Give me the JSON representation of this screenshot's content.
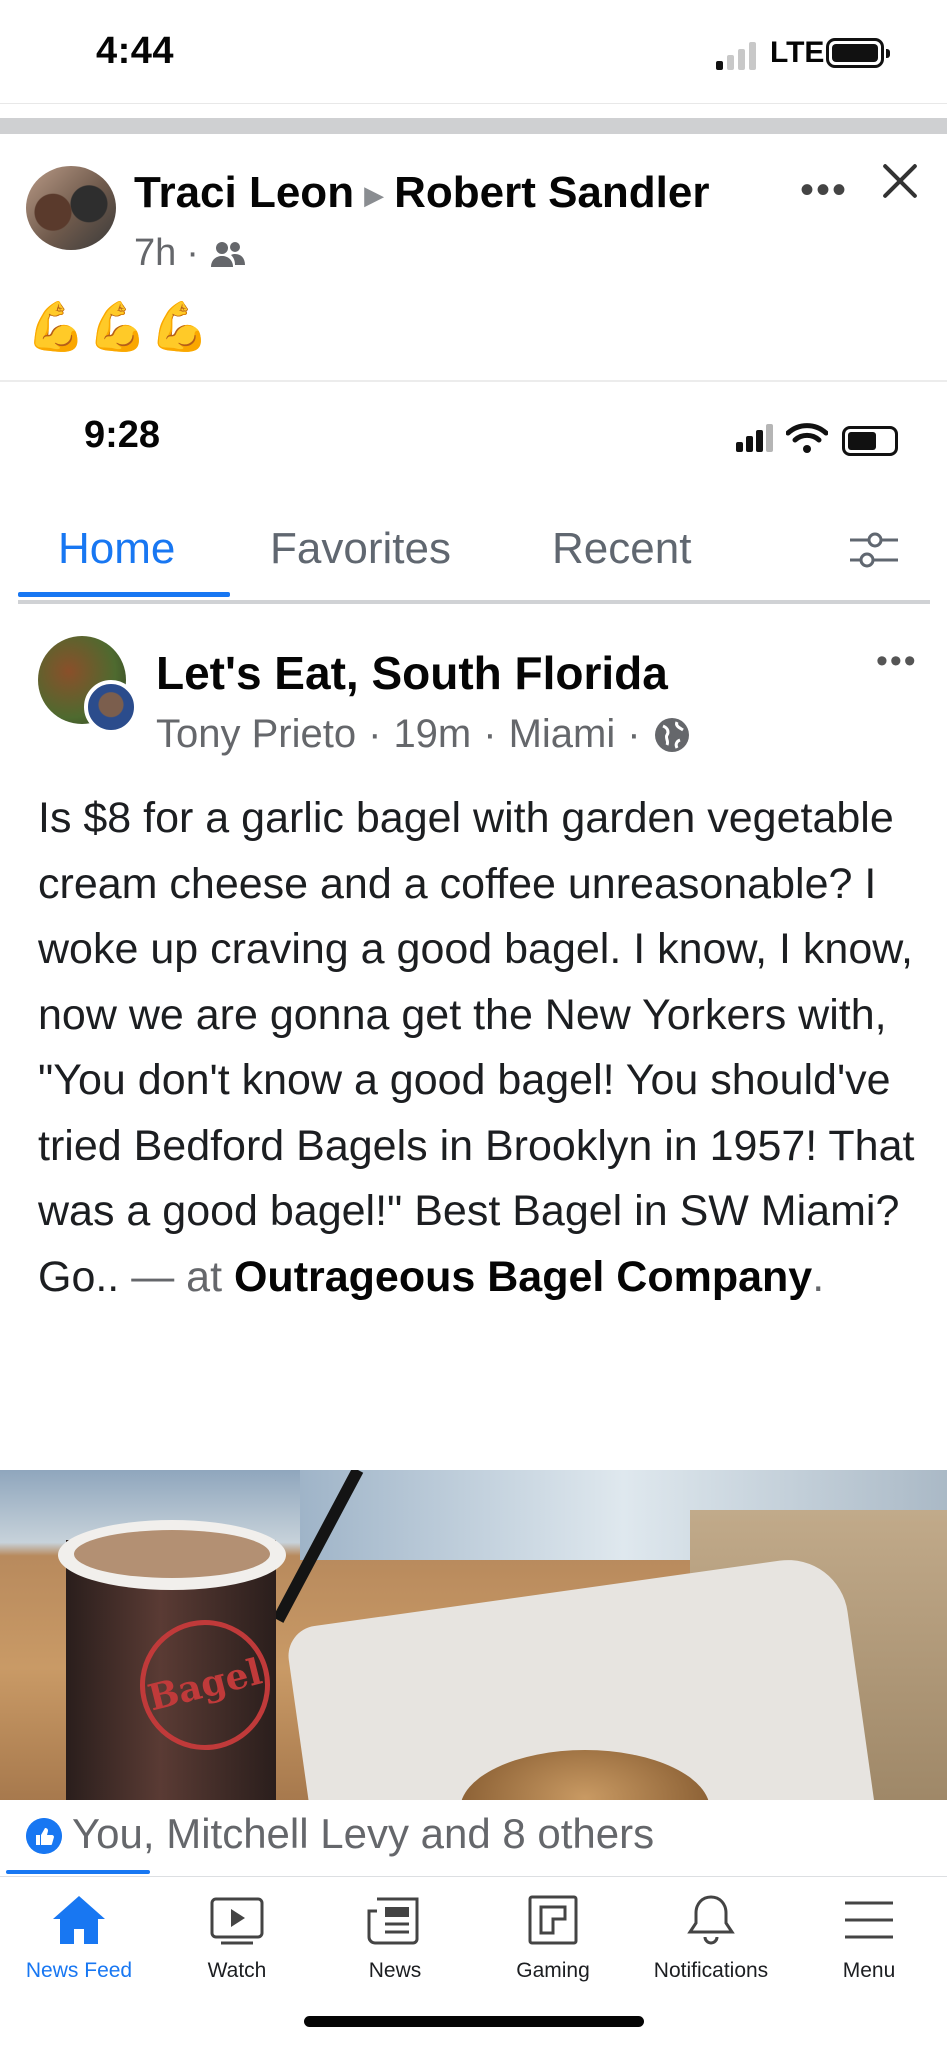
{
  "status_bar": {
    "time": "4:44",
    "network": "LTE"
  },
  "post": {
    "author": "Traci Leon",
    "recipient": "Robert Sandler",
    "time_ago": "7h",
    "audience_icon": "friends-icon",
    "emoji_text": "💪💪💪"
  },
  "shared_screenshot": {
    "status_time": "9:28",
    "tabs": [
      {
        "label": "Home",
        "active": true
      },
      {
        "label": "Favorites",
        "active": false
      },
      {
        "label": "Recent",
        "active": false
      }
    ],
    "group_name": "Let's Eat, South Florida",
    "poster": "Tony Prieto",
    "time_ago": "19m",
    "location": "Miami",
    "body_text": "Is $8 for a garlic bagel with garden vegetable cream cheese and a coffee unreasonable?  I woke up craving a good bagel. I know, I know, now we are gonna get the New Yorkers with, \"You don't know a good bagel! You should've tried Bedford Bagels in Brooklyn in 1957! That was a good bagel!\" Best Bagel in SW Miami? Go..",
    "at_connector": "— at",
    "place": "Outrageous Bagel Company",
    "place_suffix": ".",
    "photo_logo": "Bagel"
  },
  "reactions": {
    "you": "You,",
    "rest": " Mitchell Levy and 8 others"
  },
  "bottom_nav": [
    {
      "label": "News Feed",
      "icon": "home-icon",
      "active": true
    },
    {
      "label": "Watch",
      "icon": "watch-icon",
      "active": false
    },
    {
      "label": "News",
      "icon": "news-icon",
      "active": false
    },
    {
      "label": "Gaming",
      "icon": "gaming-icon",
      "active": false
    },
    {
      "label": "Notifications",
      "icon": "bell-icon",
      "active": false
    },
    {
      "label": "Menu",
      "icon": "menu-icon",
      "active": false
    }
  ],
  "colors": {
    "accent": "#1877f2",
    "secondary_text": "#65676b"
  }
}
